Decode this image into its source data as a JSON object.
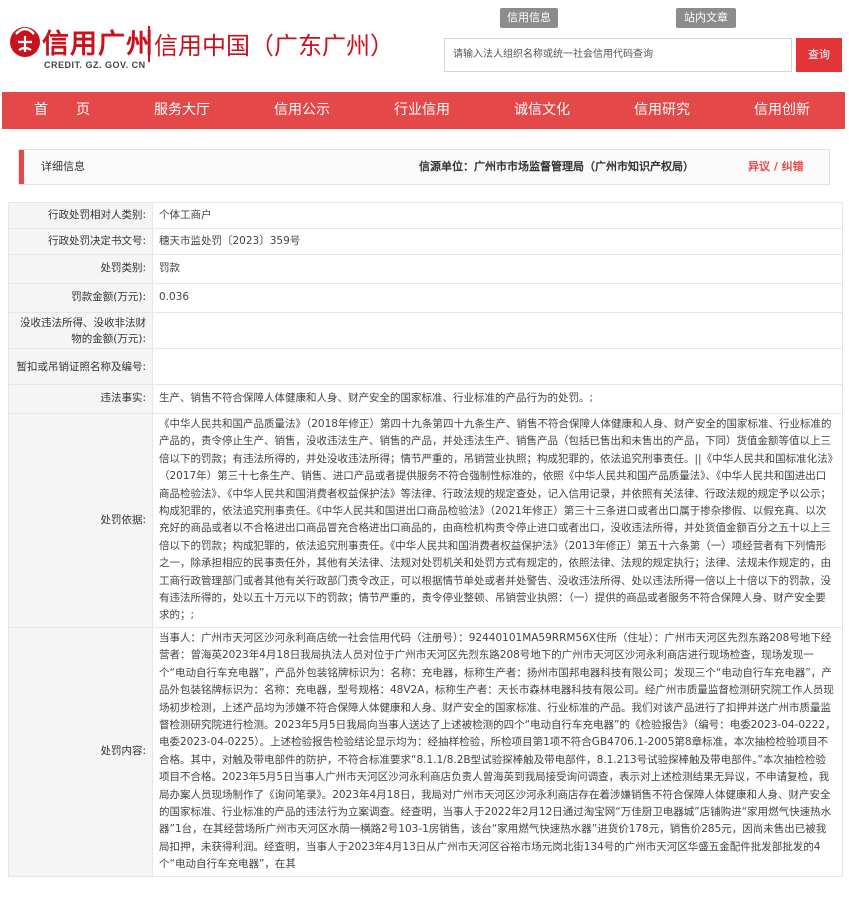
{
  "header": {
    "logo_main": "信用广州",
    "logo_sub": "CREDIT. GZ. GOV. CN",
    "logo_cn": "信用中国（广东广州）",
    "link_credit_info": "信用信息",
    "link_site_search": "站内文章",
    "search_placeholder": "请输入法人组织名称或统一社会信用代码查询",
    "search_button": "查询"
  },
  "nav": {
    "items": [
      "首　　页",
      "服务大厅",
      "信用公示",
      "行业信用",
      "诚信文化",
      "信用研究",
      "信用创新"
    ]
  },
  "detail": {
    "title": "详细信息",
    "source": "信源单位：广州市市场监督管理局（广州市知识产权局）",
    "objection": "异议 / 纠错"
  },
  "rows": {
    "party_category": {
      "label": "行政处罚相对人类别:",
      "value": "个体工商户"
    },
    "decision_no": {
      "label": "行政处罚决定书文号:",
      "value": "穗天市监处罚〔2023〕359号"
    },
    "penalty_type": {
      "label": "处罚类别:",
      "value": "罚款"
    },
    "fine_amount": {
      "label": "罚款金额(万元):",
      "value": "0.036"
    },
    "confiscated_amount": {
      "label": "没收违法所得、没收非法财物的金额(万元):",
      "value": ""
    },
    "license_suspension": {
      "label": "暂扣或吊销证照名称及编号:",
      "value": ""
    },
    "violation": {
      "label": "违法事实:",
      "value": "生产、销售不符合保障人体健康和人身、财产安全的国家标准、行业标准的产品行为的处罚。;"
    },
    "basis": {
      "label": "处罚依据:",
      "value": "《中华人民共和国产品质量法》（2018年修正）第四十九条第四十九条生产、销售不符合保障人体健康和人身、财产安全的国家标准、行业标准的产品的，责令停止生产、销售，没收违法生产、销售的产品，并处违法生产、销售产品（包括已售出和未售出的产品，下同）货值金额等值以上三倍以下的罚款；有违法所得的，并处没收违法所得；情节严重的，吊销营业执照；构成犯罪的，依法追究刑事责任。||《中华人民共和国标准化法》（2017年）第三十七条生产、销售、进口产品或者提供服务不符合强制性标准的，依照《中华人民共和国产品质量法》、《中华人民共和国进出口商品检验法》、《中华人民共和国消费者权益保护法》等法律、行政法规的规定查处，记入信用记录，并依照有关法律、行政法规的规定予以公示；构成犯罪的，依法追究刑事责任。《中华人民共和国进出口商品检验法》（2021年修正）第三十三条进口或者出口属于掺杂掺假、以假充真、以次充好的商品或者以不合格进出口商品冒充合格进出口商品的，由商检机构责令停止进口或者出口，没收违法所得，并处货值金额百分之五十以上三倍以下的罚款；构成犯罪的，依法追究刑事责任。《中华人民共和国消费者权益保护法》（2013年修正）第五十六条第（一）项经营者有下列情形之一，除承担相应的民事责任外，其他有关法律、法规对处罚机关和处罚方式有规定的，依照法律、法规的规定执行；法律、法规未作规定的，由工商行政管理部门或者其他有关行政部门责令改正，可以根据情节单处或者并处警告、没收违法所得、处以违法所得一倍以上十倍以下的罚款，没有违法所得的，处以五十万元以下的罚款；情节严重的，责令停业整顿、吊销营业执照：（一）提供的商品或者服务不符合保障人身、财产安全要求的；;"
    },
    "content": {
      "label": "处罚内容:",
      "value": "当事人：广州市天河区沙河永利商店统一社会信用代码（注册号）：92440101MA59RRM56X住所（住址）：广州市天河区先烈东路208号地下经营者：曾海英2023年4月18日我局执法人员对位于广州市天河区先烈东路208号地下的广州市天河区沙河永利商店进行现场检查，现场发现一个“电动自行车充电器”，产品外包装铭牌标识为：名称：充电器，标称生产者：扬州市国邦电器科技有限公司；发现三个“电动自行车充电器”，产品外包装铭牌标识为：名称：充电器，型号规格：48V2A，标称生产者：天长市森林电器科技有限公司。经广州市质量监督检测研究院工作人员现场初步检测，上述产品均为涉嫌不符合保障人体健康和人身、财产安全的国家标准、行业标准的产品。我们对该产品进行了扣押并送广州市质量监督检测研究院进行检测。2023年5月5日我局向当事人送达了上述被检测的四个“电动自行车充电器”的《检验报告》（编号：电委2023-04-0222，电委2023-04-0225）。上述检验报告检验结论显示均为：经抽样检验，所检项目第1项不符合GB4706.1-2005第8章标准，本次抽检检验项目不合格。其中，对触及带电部件的防护，不符合标准要求“8.1.1/8.2B型试验探棒触及带电部件，8.1.213号试验探棒触及带电部件。”本次抽检检验项目不合格。2023年5月5日当事人广州市天河区沙河永利商店负责人曾海英到我局接受询问调查，表示对上述检测结果无异议，不申请复检，我局办案人员现场制作了《询问笔录》。2023年4月18日，我局对广州市天河区沙河永利商店存在着涉嫌销售不符合保障人体健康和人身、财产安全的国家标准、行业标准的产品的违法行为立案调查。经查明，当事人于2022年2月12日通过淘宝网“万佳厨卫电器城”店铺购进“家用燃气快速热水器”1台，在其经营场所广州市天河区水荫一横路2号103-1房销售，该台“家用燃气快速热水器”进货价178元，销售价285元，因尚未售出已被我局扣押，未获得利润。经查明，当事人于2023年4月13日从广州市天河区谷裕市场元岗北街134号的广州市天河区华盛五金配件批发部批发的4个“电动自行车充电器”，在其"
    }
  }
}
